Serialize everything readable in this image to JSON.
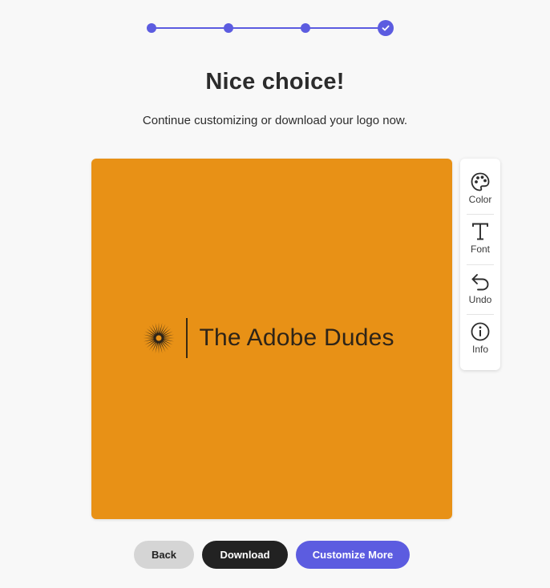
{
  "stepper": {
    "total_steps": 4,
    "current_step": 4,
    "accent_color": "#5c5ce0",
    "completed_icon": "checkmark-icon"
  },
  "header": {
    "title": "Nice choice!",
    "subtitle": "Continue customizing or download your logo now."
  },
  "preview": {
    "background_color": "#e89116",
    "logo_text": "The Adobe Dudes",
    "logo_mark_icon": "sunburst-icon",
    "logo_text_color": "#2e2418"
  },
  "toolbar": {
    "items": [
      {
        "label": "Color",
        "icon": "palette-icon"
      },
      {
        "label": "Font",
        "icon": "font-icon"
      },
      {
        "label": "Undo",
        "icon": "undo-icon"
      },
      {
        "label": "Info",
        "icon": "info-icon"
      }
    ]
  },
  "actions": {
    "back_label": "Back",
    "download_label": "Download",
    "customize_label": "Customize More"
  }
}
